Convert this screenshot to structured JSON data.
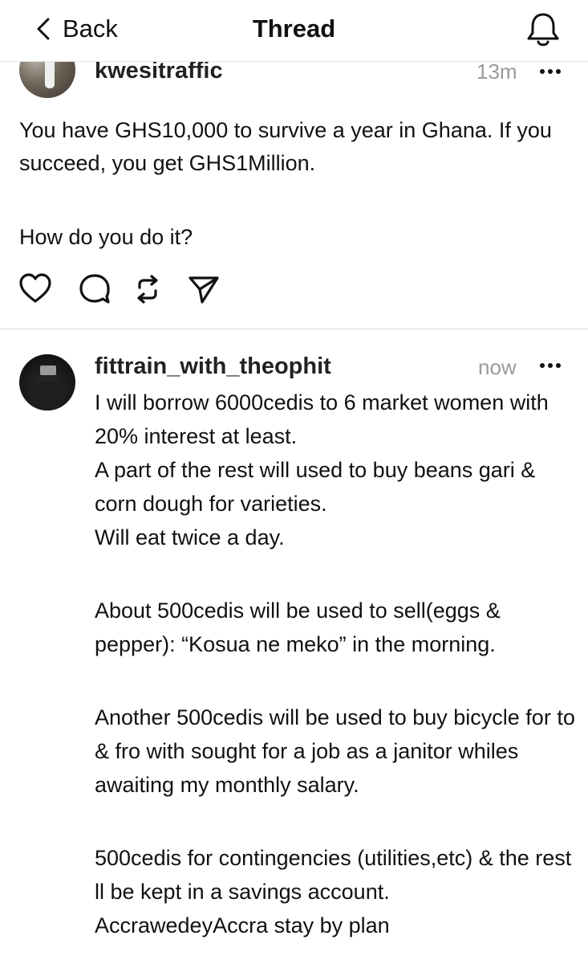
{
  "header": {
    "back_label": "Back",
    "title": "Thread",
    "back_icon": "chevron-left-icon",
    "notification_icon": "bell-icon"
  },
  "original_post": {
    "username": "kwesitraffic",
    "time": "13m",
    "lines": [
      "You have GHS10,000 to survive a year in Ghana. If you succeed, you get GHS1Million.",
      "How do you do it?"
    ],
    "actions": [
      "heart-icon",
      "comment-icon",
      "repost-icon",
      "share-icon"
    ]
  },
  "reply": {
    "username": "fittrain_with_theophit",
    "time": "now",
    "paragraphs": [
      "I will borrow 6000cedis to 6 market women with 20% interest at least.",
      "A part of the rest will used to buy beans gari & corn dough for varieties.",
      "Will eat twice a day.",
      "About 500cedis will be used to sell(eggs & pepper): “Kosua ne meko” in the morning.",
      "Another 500cedis will be used to buy bicycle for to & fro with sought for a job as a janitor whiles awaiting my monthly salary.",
      "500cedis for contingencies (utilities,etc) & the rest ll be kept in a savings account.",
      "AccrawedeyAccra stay by plan"
    ]
  },
  "colors": {
    "text": "#111111",
    "muted": "#9a9a9a",
    "divider": "#dcdcdc",
    "background": "#ffffff"
  }
}
